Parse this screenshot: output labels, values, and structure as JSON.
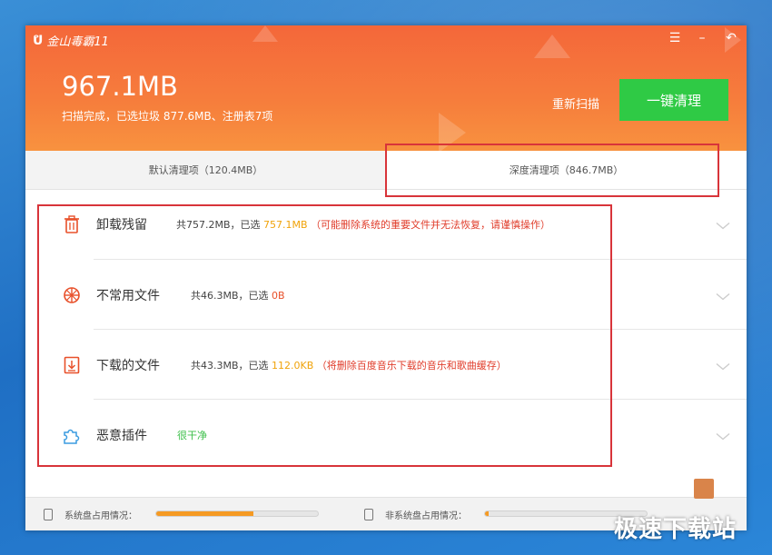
{
  "app": {
    "name": "金山毒霸11"
  },
  "window_controls": {
    "menu": "☰",
    "minimize": "–",
    "restore": "↶"
  },
  "header": {
    "total_size": "967.1MB",
    "summary": "扫描完成，已选垃圾 877.6MB、注册表7项",
    "rescan_label": "重新扫描",
    "clean_button_label": "一键清理"
  },
  "tabs": [
    {
      "label": "默认清理项（120.4MB）"
    },
    {
      "label": "深度清理项（846.7MB）",
      "selected": true
    }
  ],
  "items": [
    {
      "icon": "trash-icon",
      "name": "卸载残留",
      "total_text": "共757.2MB，已选",
      "selected": "757.1MB",
      "selected_color": "#f0a30a",
      "note": "（可能删除系统的重要文件并无法恢复，请谨慎操作）"
    },
    {
      "icon": "globe-icon",
      "name": "不常用文件",
      "total_text": "共46.3MB，已选",
      "selected": "0B",
      "selected_color": "#e8502a",
      "note": ""
    },
    {
      "icon": "download-icon",
      "name": "下载的文件",
      "total_text": "共43.3MB，已选",
      "selected": "112.0KB",
      "selected_color": "#f0a30a",
      "note": "（将删除百度音乐下载的音乐和歌曲缓存）"
    },
    {
      "icon": "puzzle-icon",
      "name": "恶意插件",
      "status": "很干净"
    }
  ],
  "footer": {
    "system_disk_label": "系统盘占用情况：",
    "system_disk_usage": 0.6,
    "other_disk_label": "非系统盘占用情况：",
    "other_disk_usage": 0.02
  },
  "watermark": "极速下载站",
  "colors": {
    "accent": "#f4673a",
    "clean_button": "#2fca45",
    "annotation_box": "#d8343a"
  }
}
